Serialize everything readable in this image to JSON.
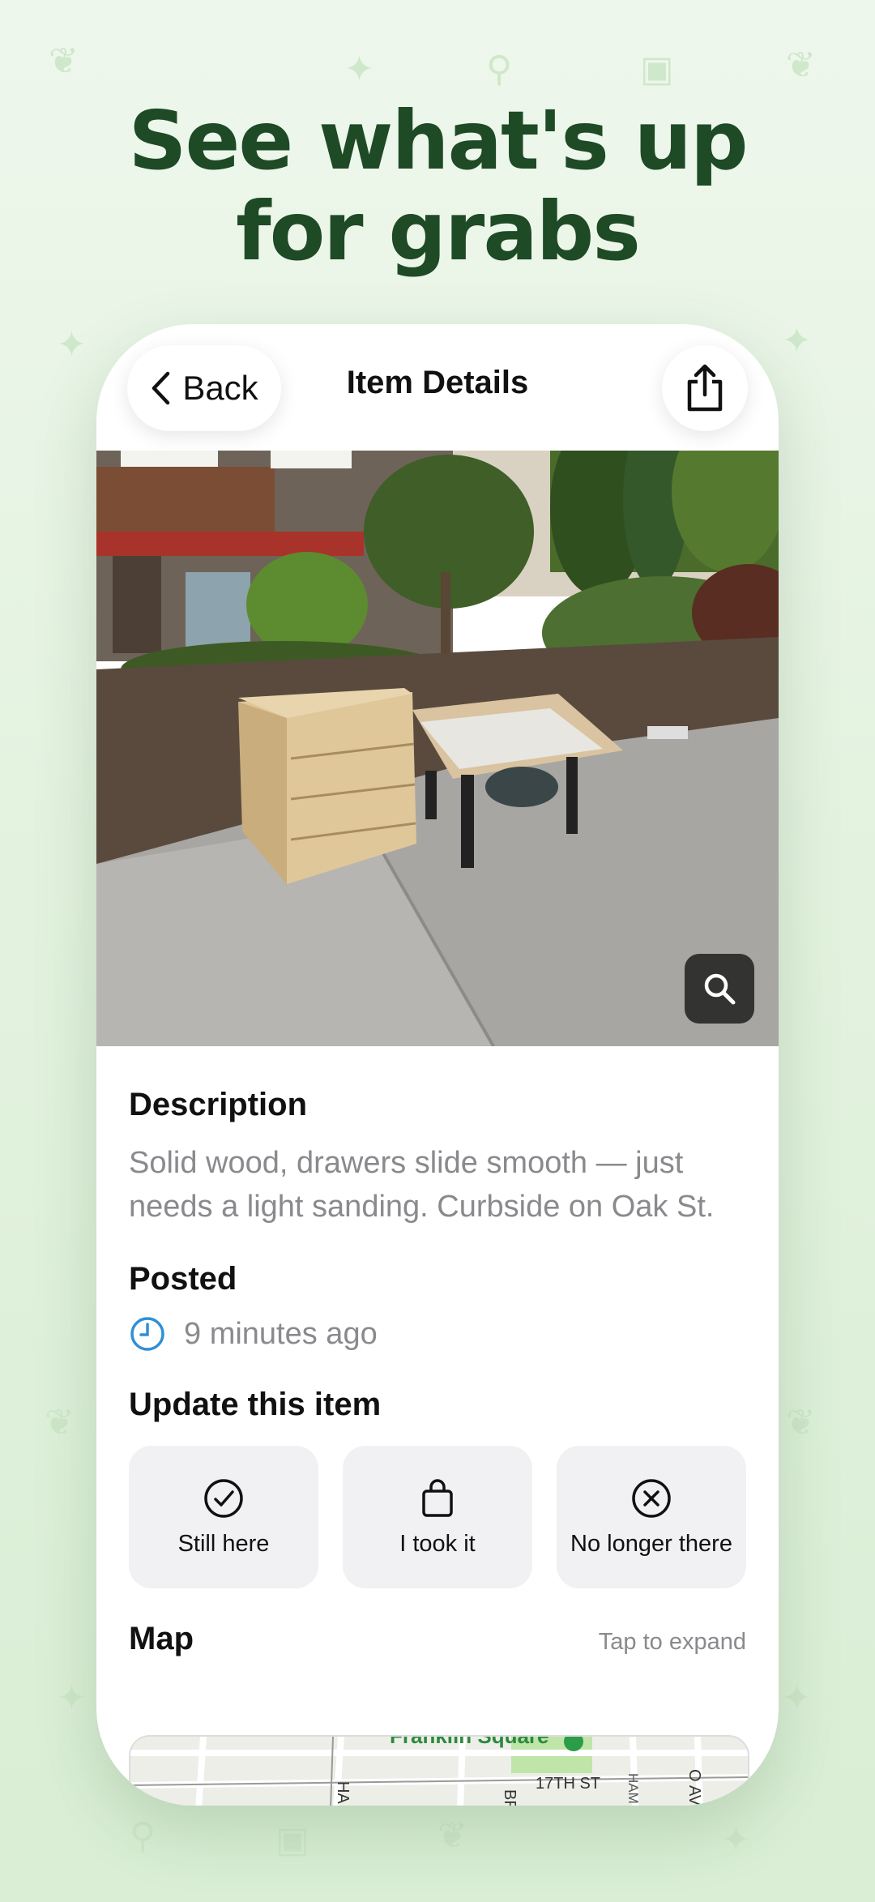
{
  "headline": {
    "line1": "See what's up",
    "line2": "for grabs"
  },
  "nav": {
    "back_label": "Back",
    "title": "Item Details"
  },
  "description": {
    "title": "Description",
    "text": "Solid wood, drawers slide smooth — just needs a light sanding. Curbside on Oak St."
  },
  "posted": {
    "title": "Posted",
    "time": "9 minutes ago"
  },
  "update": {
    "title": "Update this item",
    "actions": [
      {
        "label": "Still here",
        "icon": "check-circle-icon"
      },
      {
        "label": "I took it",
        "icon": "bag-icon"
      },
      {
        "label": "No longer there",
        "icon": "x-circle-icon"
      }
    ]
  },
  "map": {
    "title": "Map",
    "hint": "Tap to expand",
    "labels": {
      "park": "Franklin Square",
      "street1": "17TH ST",
      "street2": "O AVE",
      "street3": "HAM",
      "street4": "BR",
      "street5": "HA"
    }
  },
  "colors": {
    "brand_green": "#1e4a26",
    "clock_blue": "#2f8fd6",
    "background": "#e6f3e2"
  }
}
